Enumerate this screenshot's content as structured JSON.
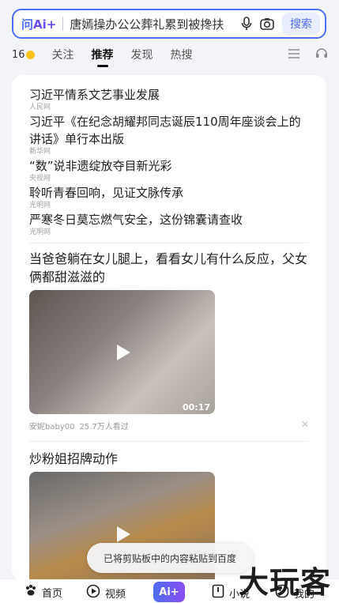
{
  "search": {
    "logo_main": "问",
    "logo_ai": "Ai+",
    "query": "唐嫣操办公公葬礼累到被搀扶",
    "button": "搜索"
  },
  "tabs": {
    "weather_temp": "16",
    "items": [
      "关注",
      "推荐",
      "发现",
      "热搜"
    ],
    "active": "推荐"
  },
  "news": [
    {
      "title": "习近平情系文艺事业发展",
      "source": "人民网"
    },
    {
      "title": "习近平《在纪念胡耀邦同志诞辰110周年座谈会上的讲话》单行本出版",
      "source": "新华网"
    },
    {
      "title": "“数”说非遗绽放夺目新光彩",
      "source": "央视网"
    },
    {
      "title": "聆听青春回响，见证文脉传承",
      "source": "光明网"
    },
    {
      "title": "严寒冬日莫忘燃气安全，这份锦囊请查收",
      "source": "光明网"
    }
  ],
  "videos": [
    {
      "title": "当爸爸躺在女儿腿上，看看女儿有什么反应，父女俩都甜滋滋的",
      "duration": "00:17",
      "author": "安妮baby00",
      "views": "25.7万人看过"
    },
    {
      "title": "炒粉姐招牌动作"
    }
  ],
  "toast": "已将剪贴板中的内容粘贴到百度",
  "bottom_nav": {
    "home": "首页",
    "video": "视频",
    "ai": "Ai+",
    "novel": "小说",
    "mine": "我的"
  },
  "watermark": "大玩客",
  "colors": {
    "accent": "#4e6ef2",
    "accent2": "#8a4ef2"
  }
}
